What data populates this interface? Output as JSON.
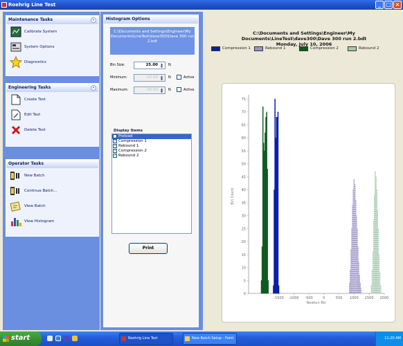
{
  "window": {
    "title": "Roehrig Line Test"
  },
  "maintenance_tasks": {
    "header": "Maintenance Tasks",
    "items": [
      {
        "label": "Calibrate System",
        "icon": "calibrate-icon"
      },
      {
        "label": "System Options",
        "icon": "system-options-icon"
      },
      {
        "label": "Diagnostics",
        "icon": "diagnostics-star-icon"
      }
    ]
  },
  "engineering_tasks": {
    "header": "Engineering Tasks",
    "items": [
      {
        "label": "Create Test",
        "icon": "create-test-icon"
      },
      {
        "label": "Edit Test",
        "icon": "edit-test-icon"
      },
      {
        "label": "Delete Test",
        "icon": "delete-test-icon"
      }
    ]
  },
  "operator_tasks": {
    "header": "Operator Tasks",
    "items": [
      {
        "label": "New Batch",
        "icon": "new-batch-icon"
      },
      {
        "label": "Continue Batch...",
        "icon": "continue-batch-icon"
      },
      {
        "label": "View Batch",
        "icon": "view-batch-icon"
      },
      {
        "label": "View Histogram",
        "icon": "view-histogram-icon"
      }
    ]
  },
  "histogram_options": {
    "header": "Histogram Options",
    "file_path": "C:\\Documents and Settings\\Engineer\\My Documents\\LineTest\\dave300\\Dave 300 run 2.bdt",
    "bin_size": {
      "label": "Bin Size:",
      "value": "25.00",
      "unit": "N"
    },
    "minimum": {
      "label": "Minimum:",
      "value": "-25.00",
      "unit": "N",
      "active_label": "Active",
      "active": false
    },
    "maximum": {
      "label": "Maximum:",
      "value": "-25.00",
      "unit": "N",
      "active_label": "Active",
      "active": false
    },
    "display_items_title": "Display Items",
    "display_items": [
      {
        "label": "Preload",
        "checked": false,
        "selected": true
      },
      {
        "label": "Compression 1",
        "checked": true,
        "selected": false
      },
      {
        "label": "Rebound 1",
        "checked": true,
        "selected": false
      },
      {
        "label": "Compression 2",
        "checked": true,
        "selected": false
      },
      {
        "label": "Rebound 2",
        "checked": true,
        "selected": false
      }
    ],
    "print_label": "Print"
  },
  "chart_header": {
    "line1": "C:\\Documents and Settings\\Engineer\\My",
    "line2": "Documents\\LineTest\\dave300\\Dave 300 run 2.bdt",
    "line3": "Monday, July 10, 2006"
  },
  "chart_data": {
    "type": "bar",
    "xlabel": "Newton Bin",
    "ylabel": "Bin Count",
    "xlim": [
      -2500,
      2000
    ],
    "ylim": [
      0,
      75
    ],
    "x_ticks": [
      -1500,
      -1000,
      -500,
      0,
      500,
      1000,
      1500,
      2000
    ],
    "x_tick_labels": [
      "-1500",
      "-1000",
      "-500",
      "0",
      "500",
      "1000",
      "1500",
      "2000"
    ],
    "y_ticks": [
      0,
      5,
      10,
      15,
      20,
      25,
      30,
      35,
      40,
      45,
      50,
      55,
      60,
      65,
      70,
      75
    ],
    "legend_position": "top",
    "series": [
      {
        "name": "Compression 1",
        "color": "#0b1ea8",
        "pattern": "solid",
        "bin_width": 25,
        "x": [
          -1675,
          -1650,
          -1625,
          -1600,
          -1575,
          -1550,
          -1525,
          -1500
        ],
        "values": [
          3,
          40,
          75,
          60,
          68,
          68,
          70,
          3
        ]
      },
      {
        "name": "Rebound 1",
        "color": "#9b94c8",
        "pattern": "hatch",
        "bin_width": 25,
        "x": [
          850,
          875,
          900,
          925,
          950,
          975,
          1000,
          1025,
          1050,
          1075,
          1100,
          1125,
          1150,
          1175,
          1200,
          1225
        ],
        "values": [
          4,
          9,
          17,
          25,
          34,
          40,
          44,
          42,
          36,
          30,
          25,
          18,
          12,
          7,
          4,
          2
        ]
      },
      {
        "name": "Compression 2",
        "color": "#0f5a1e",
        "pattern": "solid",
        "bin_width": 25,
        "x": [
          -2075,
          -2050,
          -2025,
          -2000,
          -1975,
          -1950,
          -1925,
          -1900,
          -1875,
          -1850
        ],
        "values": [
          5,
          18,
          72,
          58,
          55,
          62,
          68,
          70,
          48,
          5
        ]
      },
      {
        "name": "Rebound 2",
        "color": "#a7c8ae",
        "pattern": "hatch",
        "bin_width": 25,
        "x": [
          1575,
          1600,
          1625,
          1650,
          1675,
          1700,
          1725,
          1750,
          1775,
          1800,
          1825,
          1850,
          1875
        ],
        "values": [
          3,
          9,
          16,
          28,
          38,
          47,
          45,
          40,
          32,
          25,
          15,
          8,
          3
        ]
      }
    ]
  },
  "taskbar": {
    "start_label": "start",
    "tasks": [
      {
        "label": "Roehrig Line Test"
      },
      {
        "label": "New Batch Setup - Paint"
      }
    ],
    "clock": "11:20 AM"
  }
}
